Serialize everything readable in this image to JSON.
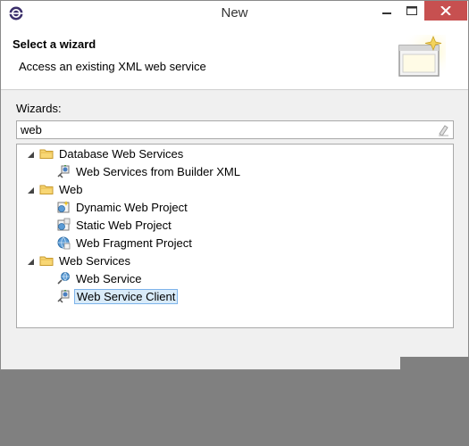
{
  "window": {
    "title": "New"
  },
  "header": {
    "title": "Select a wizard",
    "description": "Access an existing XML web service"
  },
  "filter": {
    "label": "Wizards:",
    "value": "web"
  },
  "tree": {
    "groups": [
      {
        "label": "Database Web Services",
        "expanded": true,
        "items": [
          {
            "label": "Web Services from Builder XML",
            "icon": "web-service-client-icon"
          }
        ]
      },
      {
        "label": "Web",
        "expanded": true,
        "items": [
          {
            "label": "Dynamic Web Project",
            "icon": "dynamic-web-project-icon"
          },
          {
            "label": "Static Web Project",
            "icon": "static-web-project-icon"
          },
          {
            "label": "Web Fragment Project",
            "icon": "web-fragment-project-icon"
          }
        ]
      },
      {
        "label": "Web Services",
        "expanded": true,
        "items": [
          {
            "label": "Web Service",
            "icon": "web-service-icon"
          },
          {
            "label": "Web Service Client",
            "icon": "web-service-client-icon",
            "selected": true
          }
        ]
      }
    ]
  },
  "colors": {
    "selection_fill": "#d9ebf9",
    "selection_border": "#7eb4ea",
    "close_button": "#c75050"
  }
}
